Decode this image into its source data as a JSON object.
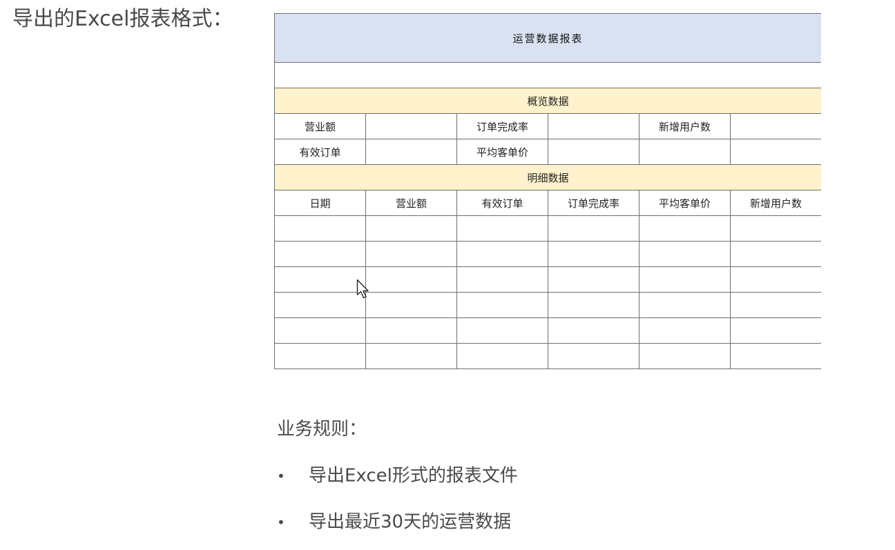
{
  "heading": "导出的Excel报表格式：",
  "report": {
    "title": "运营数据报表",
    "overview_section": "概览数据",
    "overview_rows": [
      [
        "营业额",
        "",
        "订单完成率",
        "",
        "新增用户数",
        ""
      ],
      [
        "有效订单",
        "",
        "平均客单价",
        "",
        "",
        ""
      ]
    ],
    "detail_section": "明细数据",
    "detail_headers": [
      "日期",
      "营业额",
      "有效订单",
      "订单完成率",
      "平均客单价",
      "新增用户数"
    ],
    "detail_empty_rows": 6,
    "colors": {
      "title_fill": "#d9e1f2",
      "section_fill": "#fff2cc",
      "grid_line": "#6e6e6e"
    }
  },
  "rules": {
    "title": "业务规则：",
    "items": [
      "导出Excel形式的报表文件",
      "导出最近30天的运营数据"
    ]
  }
}
